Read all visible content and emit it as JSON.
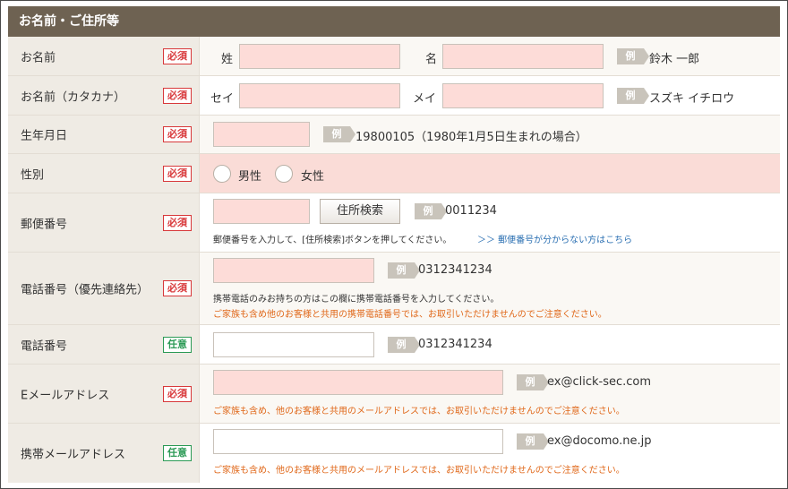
{
  "section_title": "お名前・ご住所等",
  "badges": {
    "required": "必須",
    "optional": "任意",
    "example": "例"
  },
  "rows": {
    "name": {
      "label": "お名前",
      "last_label": "姓",
      "first_label": "名",
      "example": "鈴木 一郎"
    },
    "kana": {
      "label": "お名前（カタカナ）",
      "last_label": "セイ",
      "first_label": "メイ",
      "example": "スズキ イチロウ"
    },
    "birthday": {
      "label": "生年月日",
      "example": "19800105（1980年1月5日生まれの場合）"
    },
    "gender": {
      "label": "性別",
      "male": "男性",
      "female": "女性"
    },
    "postal": {
      "label": "郵便番号",
      "button": "住所検索",
      "example": "0011234",
      "note": "郵便番号を入力して、[住所検索]ボタンを押してください。",
      "link": "＞＞ 郵便番号が分からない方はこちら"
    },
    "phone_primary": {
      "label": "電話番号（優先連絡先）",
      "example": "0312341234",
      "note": "携帯電話のみお持ちの方はこの欄に携帯電話番号を入力してください。",
      "warning": "ご家族も含め他のお客様と共用の携帯電話番号では、お取引いただけませんのでご注意ください。"
    },
    "phone": {
      "label": "電話番号",
      "example": "0312341234"
    },
    "email": {
      "label": "Eメールアドレス",
      "example": "ex@click-sec.com",
      "warning": "ご家族も含め、他のお客様と共用のメールアドレスでは、お取引いただけませんのでご注意ください。"
    },
    "mobile_email": {
      "label": "携帯メールアドレス",
      "example": "ex@docomo.ne.jp",
      "warning": "ご家族も含め、他のお客様と共用のメールアドレスでは、お取引いただけませんのでご注意ください。"
    }
  }
}
